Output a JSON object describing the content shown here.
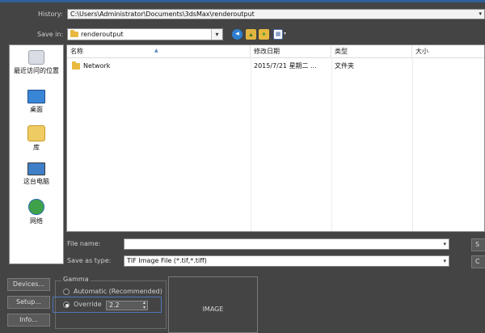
{
  "history": {
    "label": "History:",
    "value": "C:\\Users\\Administrator\\Documents\\3dsMax\\renderoutput"
  },
  "save_in": {
    "label": "Save in:",
    "value": "renderoutput",
    "toolbar_icons": [
      "back-icon",
      "up-folder-icon",
      "new-folder-icon",
      "view-menu-icon"
    ]
  },
  "places": [
    {
      "label": "最近访问的位置",
      "icon": "recent-places-icon"
    },
    {
      "label": "桌面",
      "icon": "desktop-icon"
    },
    {
      "label": "库",
      "icon": "libraries-icon"
    },
    {
      "label": "这台电脑",
      "icon": "computer-icon"
    },
    {
      "label": "网络",
      "icon": "network-icon"
    }
  ],
  "file_list": {
    "columns": [
      "名称",
      "修改日期",
      "类型",
      "大小"
    ],
    "rows": [
      {
        "name": "Network",
        "date": "2015/7/21 星期二 ...",
        "type": "文件夹",
        "size": ""
      }
    ]
  },
  "file_name": {
    "label": "File name:",
    "value": ""
  },
  "save_as_type": {
    "label": "Save as type:",
    "value": "TIF Image File (*.tif,*.tiff)"
  },
  "buttons": {
    "devices": "Devices...",
    "setup": "Setup...",
    "info": "Info...",
    "save_partial": "S",
    "cancel_partial": "C"
  },
  "gamma": {
    "title": "Gamma",
    "automatic_label": "Automatic (Recommended)",
    "override_label": "Override",
    "override_value": "2.2",
    "selected": "override"
  },
  "image_preview": {
    "label": "IMAGE"
  },
  "colors": {
    "background": "#444444",
    "accent": "#4f79b8",
    "folder": "#e8b93e"
  }
}
